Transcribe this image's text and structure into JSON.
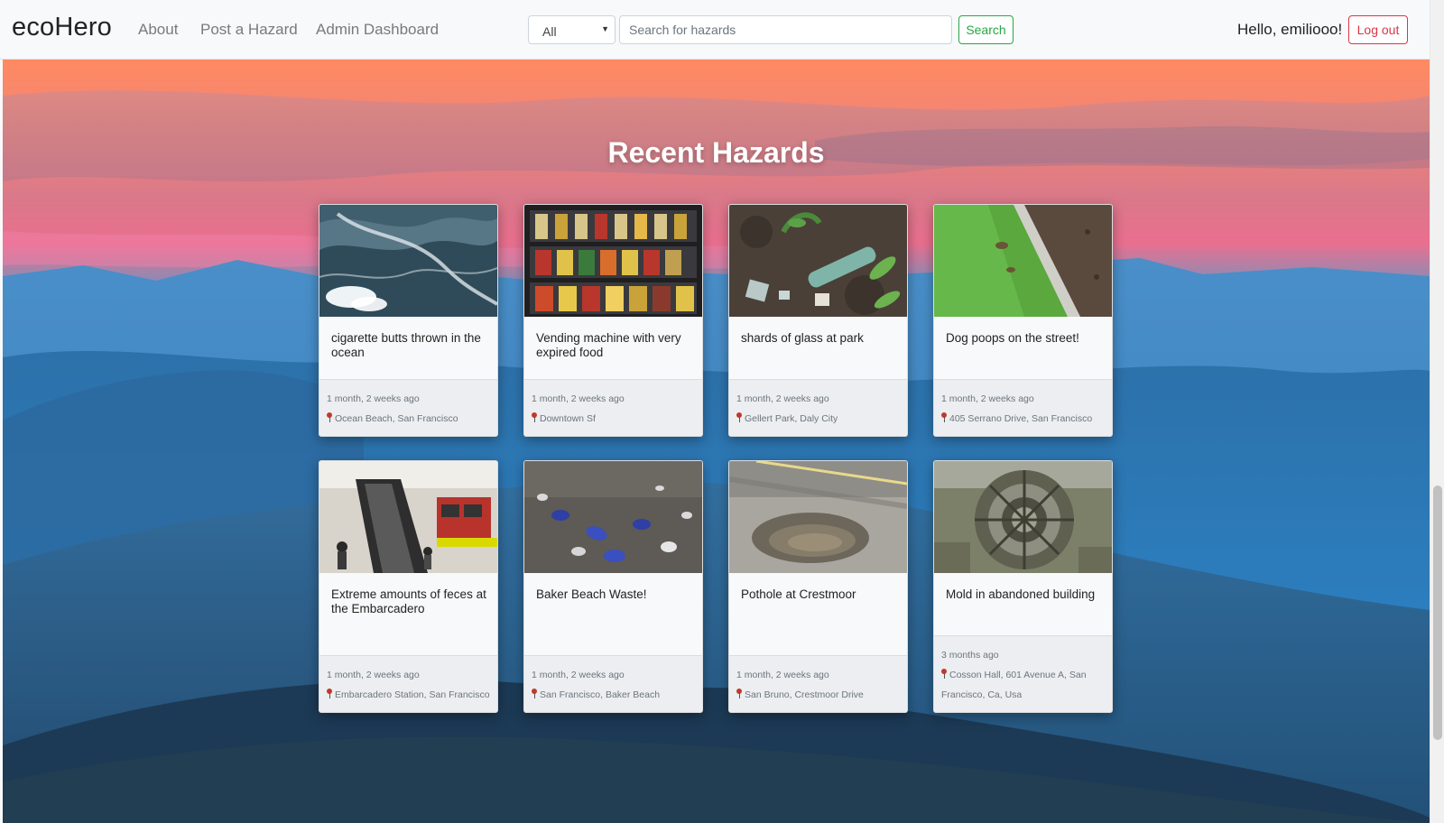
{
  "navbar": {
    "brand": "ecoHero",
    "links": {
      "about": "About",
      "post": "Post a Hazard",
      "admin": "Admin Dashboard"
    },
    "filter_value": "All",
    "search_placeholder": "Search for hazards",
    "search_button": "Search",
    "greeting": "Hello, emiliooo!",
    "logout_button": "Log out"
  },
  "colors": {
    "accent_green": "#28a745",
    "accent_red": "#dc3545",
    "pin_red": "#c0392b"
  },
  "icons": {
    "pin": "map-pin-icon",
    "caret": "caret-down-icon"
  },
  "main": {
    "title": "Recent Hazards",
    "cards": [
      {
        "title": "cigarette butts thrown in the ocean",
        "time": "1 month, 2 weeks ago",
        "location": "Ocean Beach, San Francisco"
      },
      {
        "title": "Vending machine with very expired food",
        "time": "1 month, 2 weeks ago",
        "location": "Downtown Sf"
      },
      {
        "title": "shards of glass at park",
        "time": "1 month, 2 weeks ago",
        "location": "Gellert Park, Daly City"
      },
      {
        "title": "Dog poops on the street!",
        "time": "1 month, 2 weeks ago",
        "location": "405 Serrano Drive, San Francisco"
      },
      {
        "title": "Extreme amounts of feces at the Embarcadero",
        "time": "1 month, 2 weeks ago",
        "location": "Embarcadero Station, San Francisco"
      },
      {
        "title": "Baker Beach Waste!",
        "time": "1 month, 2 weeks ago",
        "location": "San Francisco, Baker Beach"
      },
      {
        "title": "Pothole at Crestmoor",
        "time": "1 month, 2 weeks ago",
        "location": "San Bruno, Crestmoor Drive"
      },
      {
        "title": "Mold in abandoned building",
        "time": "3 months ago",
        "location": "Cosson Hall, 601 Avenue A, San Francisco, Ca, Usa"
      }
    ]
  }
}
